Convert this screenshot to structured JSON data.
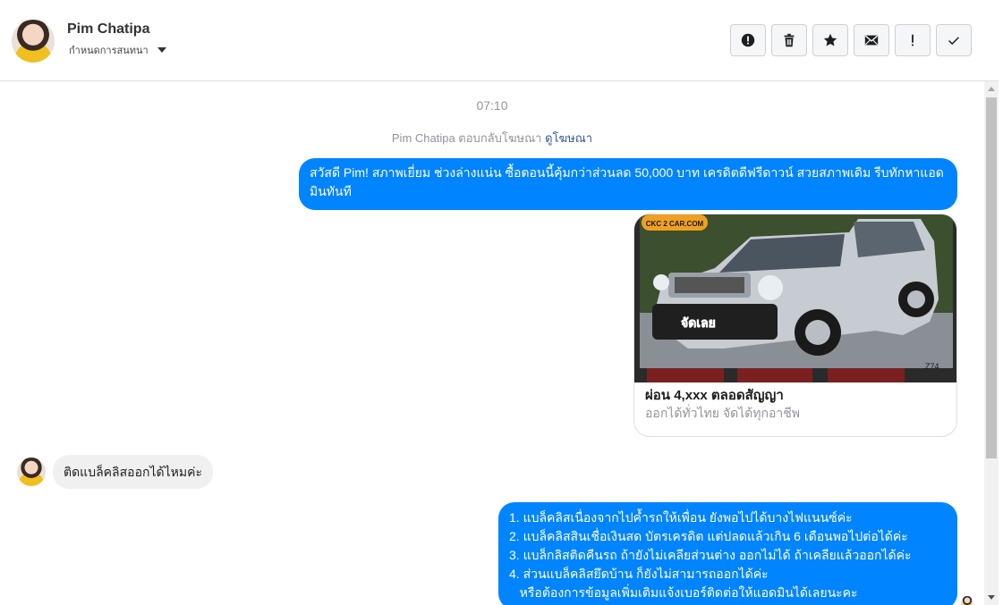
{
  "header": {
    "contact_name": "Pim Chatipa",
    "assign_label": "กำหนดการสนทนา"
  },
  "toolbar": {
    "buttons": [
      "alert-circle-icon",
      "trash-icon",
      "star-icon",
      "envelope-icon",
      "exclamation-icon",
      "checkmark-icon"
    ]
  },
  "chat": {
    "timestamp": "07:10",
    "reply_note_prefix": "Pim Chatipa ตอบกลับโฆษณา",
    "reply_note_link": "ดูโฆษณา",
    "messages": {
      "outgoing_1": "สวัสดี Pim!  สภาพเยี่ยม ช่วงล่างแน่น  ซื้อตอนนี้คุ้มกว่าส่วนลด 50,000 บาท เครดิตดีฟรีดาวน์  สวยสภาพเดิม รีบทักหาแอดมินทันที",
      "ad_card": {
        "title": "ผ่อน 4,xxx ตลอดสัญญา",
        "subtitle": "ออกได้ทั่วไทย จัดได้ทุกอาชีพ",
        "image_logo_text": "CKC 2 CAR.COM",
        "image_badge": "จัดเลย",
        "image_code": "Z74"
      },
      "incoming_1": "ติดแบล็คลิสออกได้ไหมค่ะ",
      "outgoing_2": [
        "1. แบล็คลิสเนื่องจากไปค้ำรถให้เพื่อน ยังพอไปได้บางไฟแนนซ์ค่ะ",
        "2. แบล็คลิสสินเชื่อเงินสด บัตรเครดิต แต่ปลดแล้วเกิน 6 เดือนพอไปต่อได้ค่ะ",
        "3. แบล็กลิสติดคืนรถ ถ้ายังไม่เคลียส่วนต่าง ออกไม่ได้ ถ้าเคลียแล้วออกได้ค่ะ",
        "4. ส่วนแบล็คลิสยึดบ้าน ก็ยังไม่สามารถออกได้ค่ะ",
        "   หรือต้องการข้อมูลเพิ่มเติมแจ้งเบอร์ติดต่อให้แอดมินได้เลยนะคะ"
      ]
    }
  },
  "colors": {
    "outgoing_bubble": "#0084ff",
    "incoming_bubble": "#f1f0f0",
    "link": "#385898"
  }
}
